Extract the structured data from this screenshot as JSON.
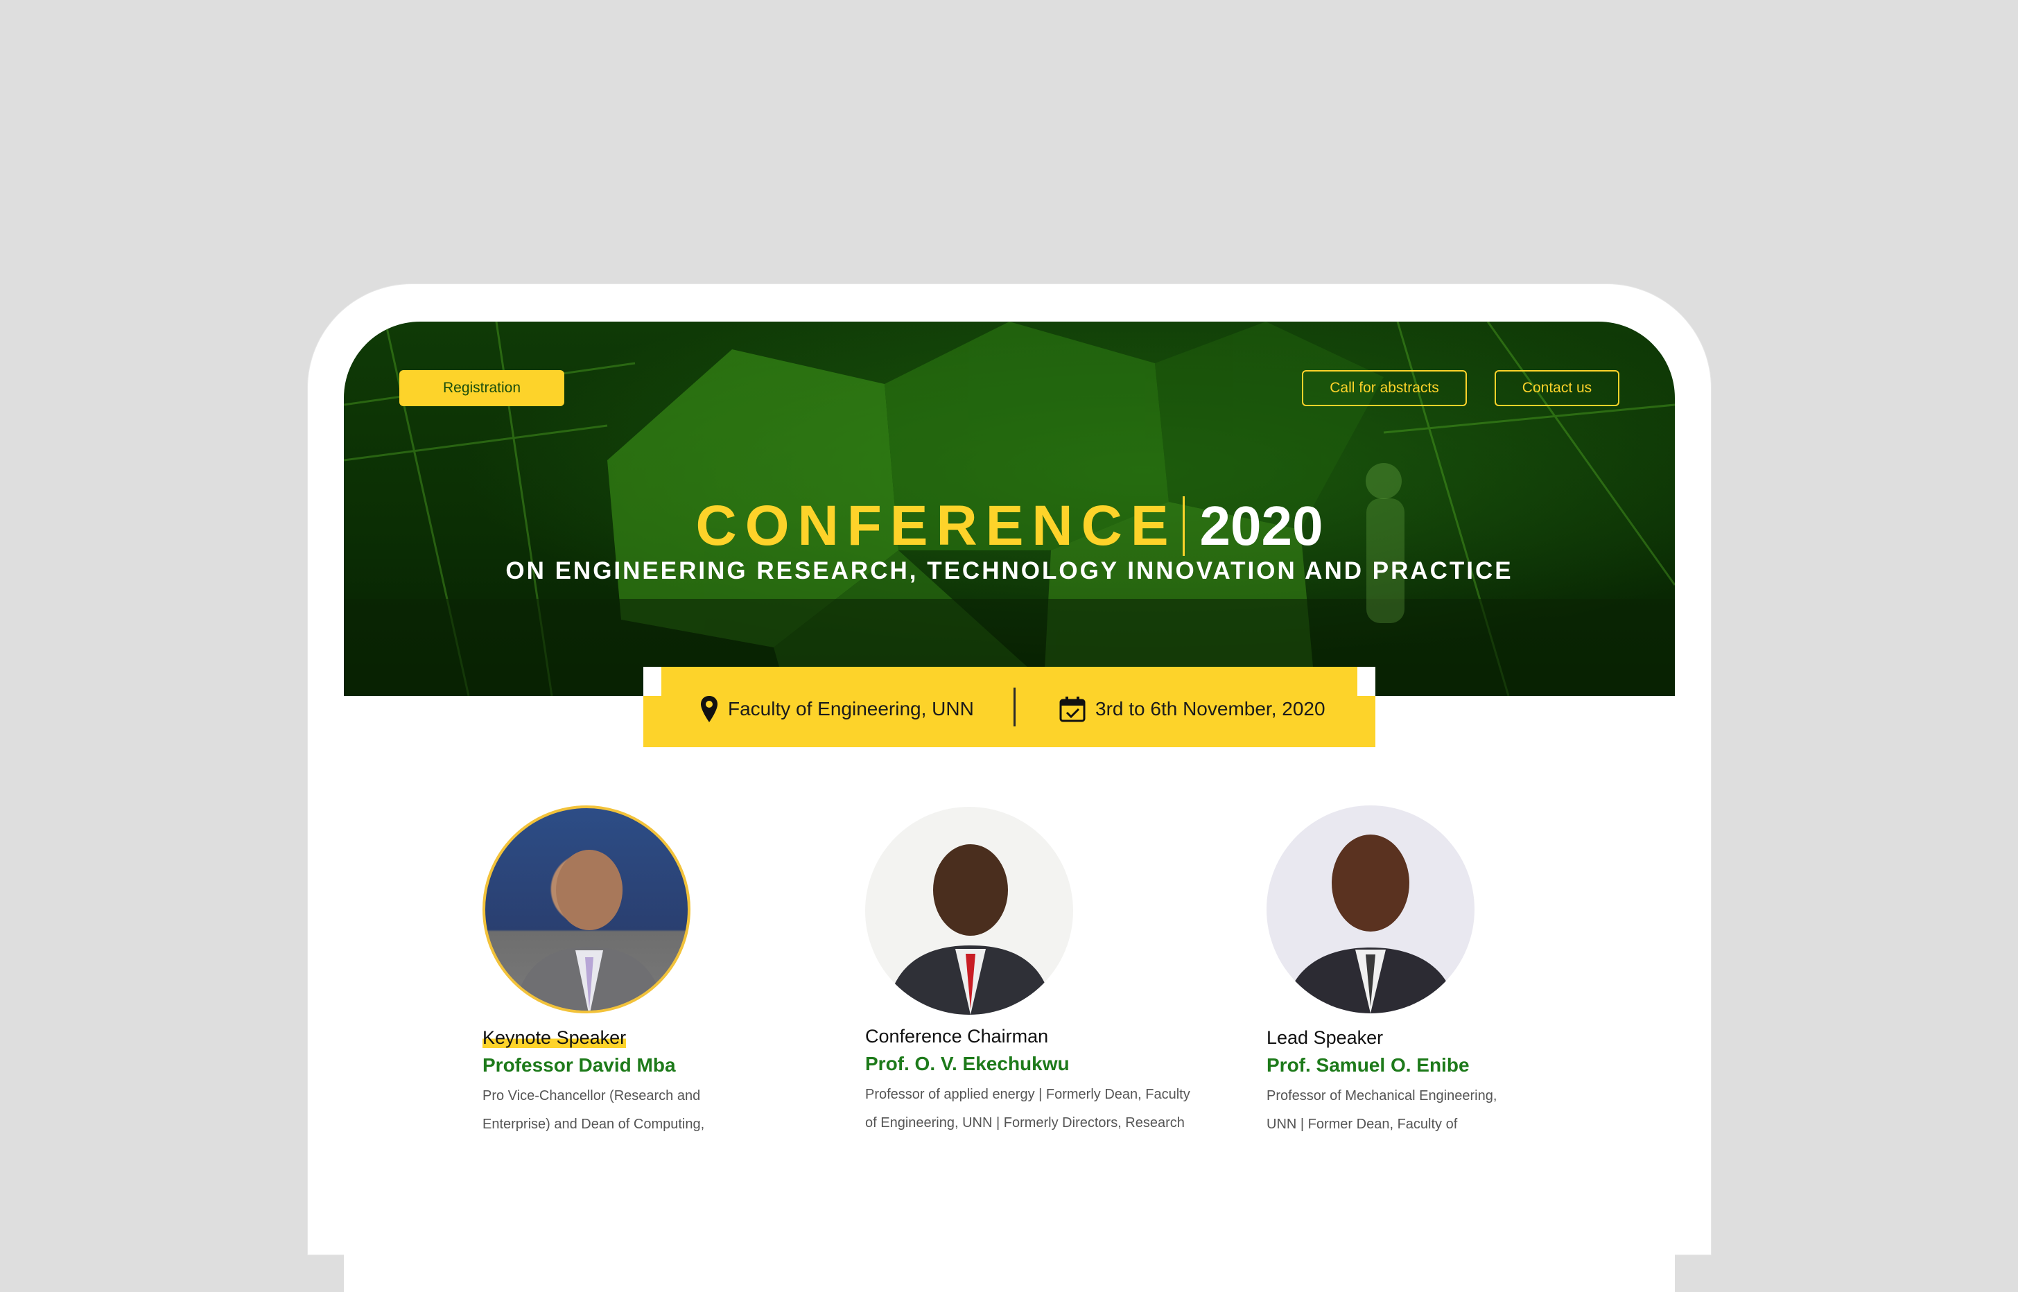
{
  "nav": {
    "registration": "Registration",
    "call_for_abstracts": "Call for abstracts",
    "contact_us": "Contact us"
  },
  "hero": {
    "title_word": "CONFERENCE",
    "title_year": "2020",
    "subtitle": "ON ENGINEERING RESEARCH, TECHNOLOGY INNOVATION AND PRACTICE"
  },
  "info": {
    "location": "Faculty of Engineering, UNN",
    "location_icon": "map-pin-icon",
    "dates": "3rd to 6th November, 2020",
    "dates_icon": "calendar-check-icon"
  },
  "speakers": [
    {
      "role": "Keynote Speaker",
      "name": "Professor David Mba",
      "description": "Pro Vice-Chancellor (Research and Enterprise) and Dean of Computing, Engineering and Media De Montfort"
    },
    {
      "role": "Conference Chairman",
      "name": "Prof. O. V. Ekechukwu",
      "description": "Professor of applied energy | Formerly Dean, Faculty of Engineering, UNN | Formerly Directors, Research and Innovation; Information"
    },
    {
      "role": "Lead Speaker",
      "name": "Prof. Samuel O. Enibe",
      "description": "Professor of Mechanical Engineering, UNN | Former Dean, Faculty of Engineering, UNN"
    }
  ],
  "colors": {
    "accent_yellow": "#fdd32a",
    "brand_green": "#1d7a1a",
    "hero_dark_green": "#0b2e04",
    "page_background": "#dedede"
  }
}
